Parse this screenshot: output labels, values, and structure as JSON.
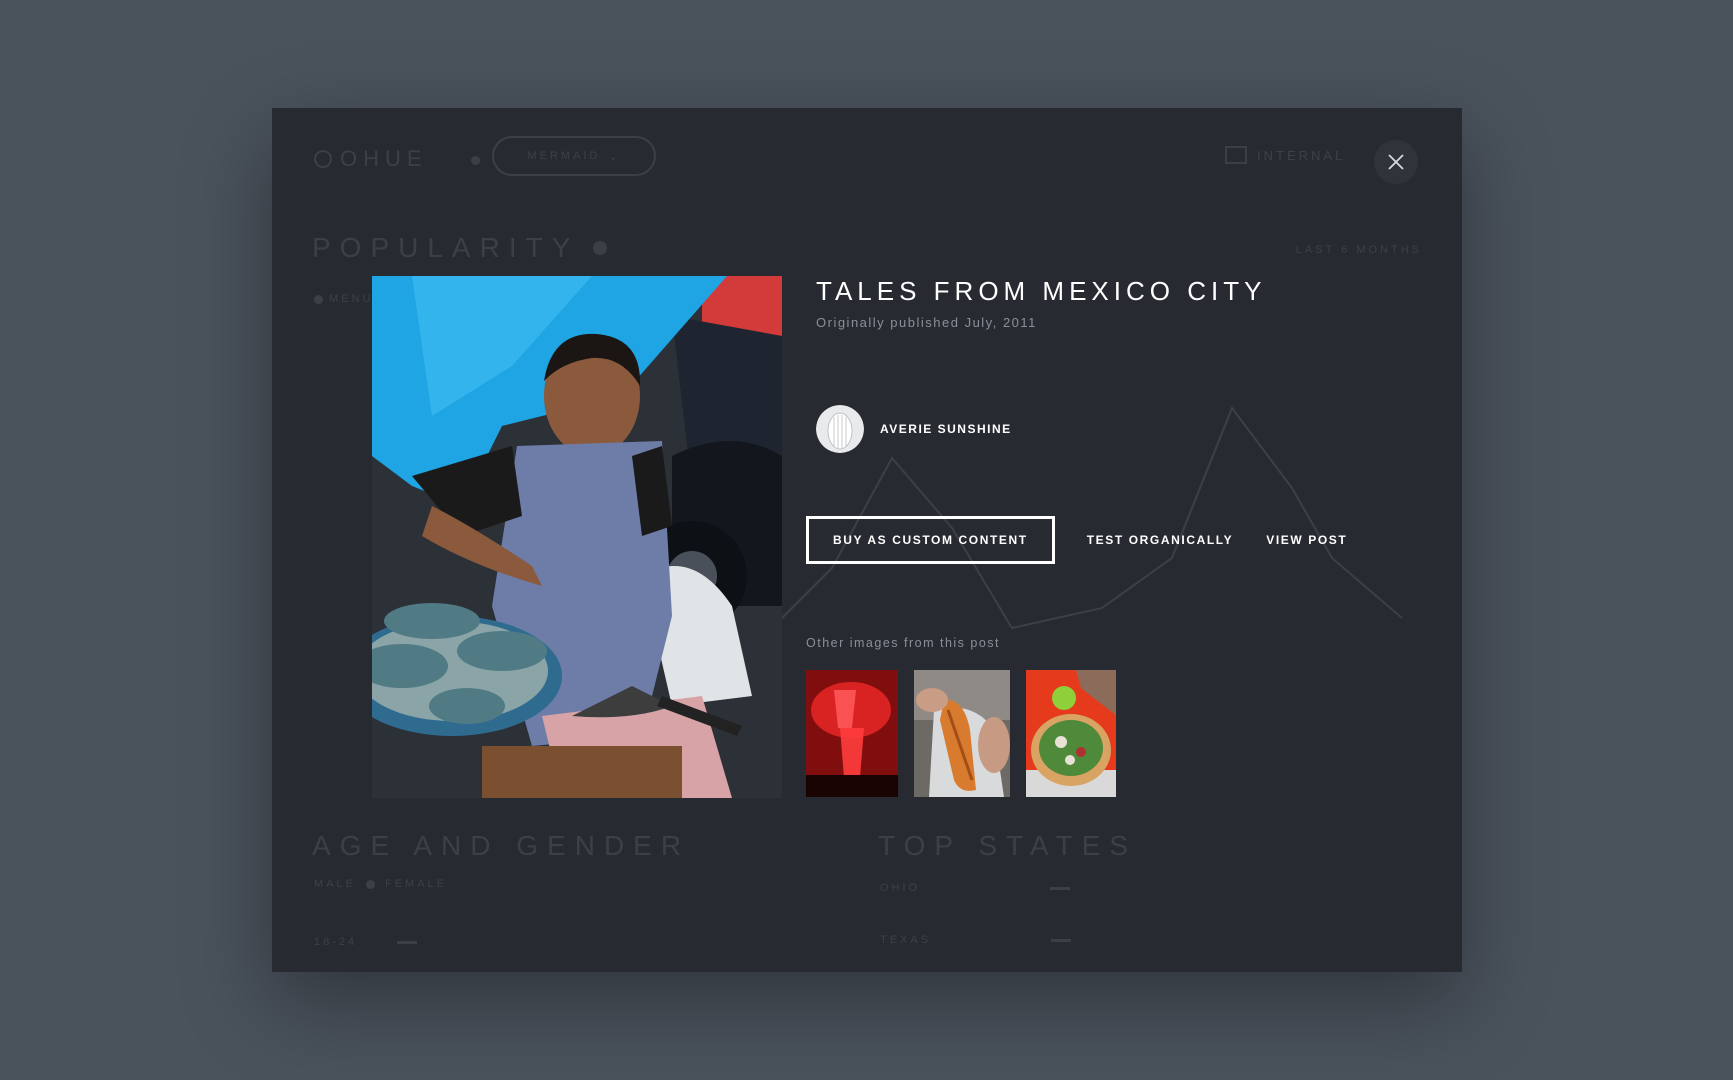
{
  "background": {
    "logo": "OHUE",
    "dropdown_label": "MERMAID",
    "international_label": "INTERNAL",
    "popularity_heading": "POPULARITY",
    "legend_item": "MENU",
    "range_label": "LAST 6 MONTHS",
    "age_gender_heading": "AGE AND GENDER",
    "male_label": "MALE",
    "female_label": "FEMALE",
    "top_states_heading": "TOP STATES",
    "age_row_label": "18-24",
    "state_row_1": "OHIO",
    "state_row_2": "TEXAS"
  },
  "modal": {
    "title": "TALES FROM MEXICO CITY",
    "published": "Originally published July, 2011",
    "author_name": "AVERIE SUNSHINE",
    "buttons": {
      "buy": "BUY AS CUSTOM CONTENT",
      "test": "TEST ORGANICALLY",
      "view": "VIEW POST"
    },
    "other_images_label": "Other images from this post",
    "thumbnails": [
      {
        "name": "red-glasses"
      },
      {
        "name": "grilled-corn"
      },
      {
        "name": "tostada-plate"
      }
    ]
  },
  "colors": {
    "page_background": "#4a525c",
    "panel_background": "#272b31",
    "text_primary": "#ffffff",
    "text_muted": "#8a9099"
  }
}
